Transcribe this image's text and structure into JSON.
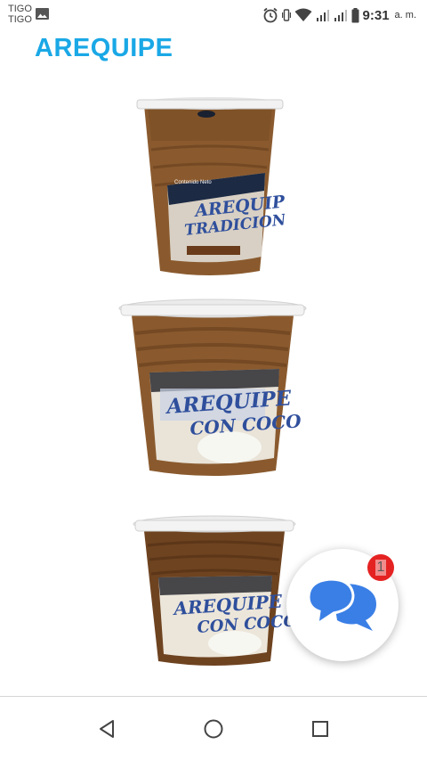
{
  "status_bar": {
    "carrier_line1": "TIGO",
    "carrier_line2": "TIGO",
    "time": "9:31",
    "ampm": "a. m.",
    "icons": [
      "image-icon",
      "alarm-icon",
      "vibrate-icon",
      "wifi-icon",
      "signal-icon",
      "signal-icon",
      "battery-icon"
    ]
  },
  "header": {
    "title": "AREQUIPE"
  },
  "products": [
    {
      "label_line1": "AREQUIPE",
      "label_line2": "TRADICIONAL",
      "net_content": "Contenido Neto"
    },
    {
      "label_line1": "AREQUIPE",
      "label_line2": "CON COCO"
    },
    {
      "label_line1": "AREQUIPE",
      "label_line2": "CON COCO"
    }
  ],
  "chat": {
    "badge_count": "1",
    "icon": "chat-bubbles-icon"
  },
  "nav_bar": {
    "icons": [
      "back-icon",
      "home-icon",
      "recents-icon"
    ]
  },
  "colors": {
    "title": "#1aa8e6",
    "chat_icon": "#3a7fe6",
    "badge": "#e52222"
  }
}
